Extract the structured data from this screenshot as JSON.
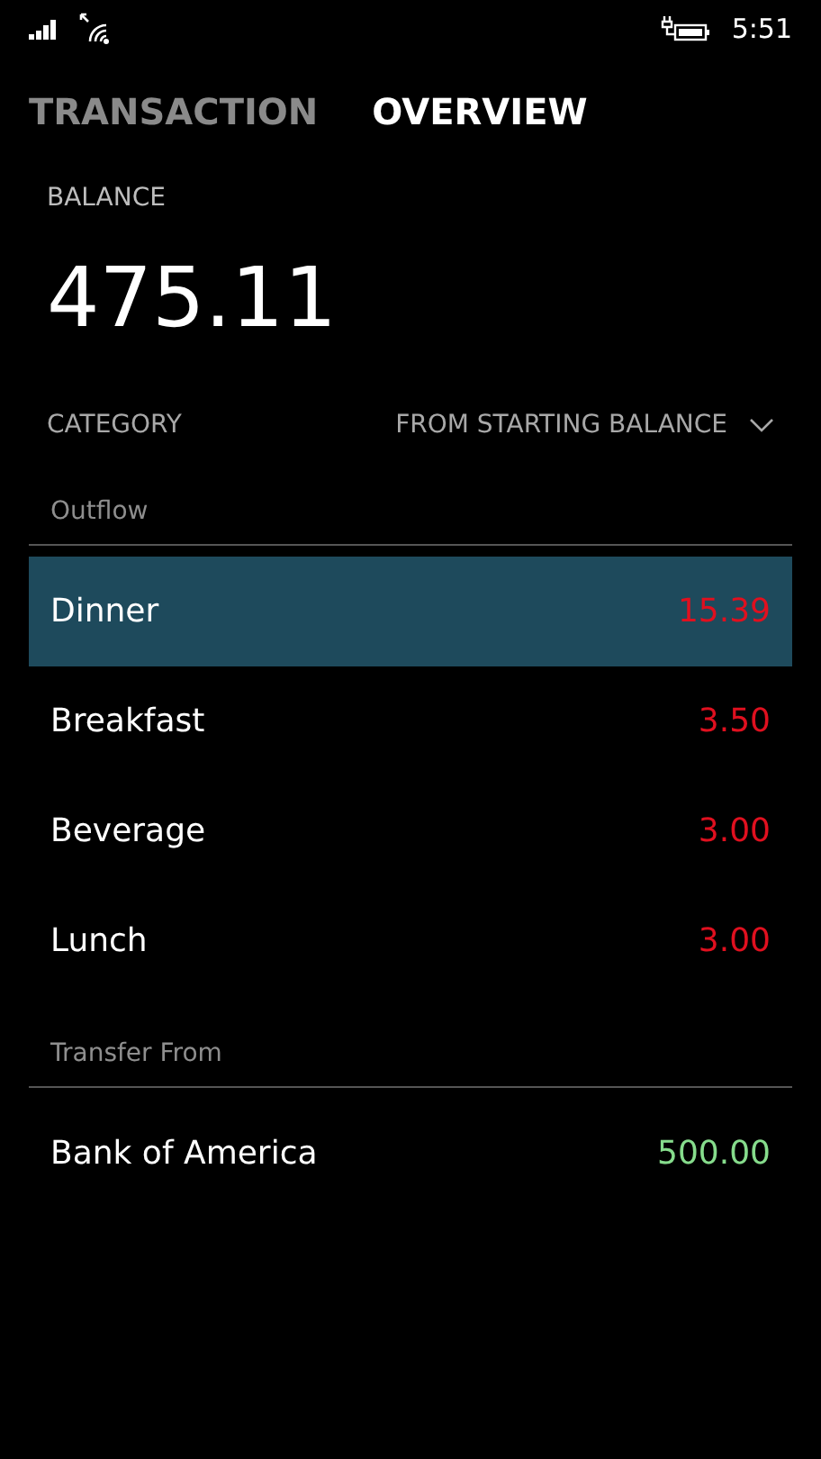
{
  "status_bar": {
    "time": "5:51"
  },
  "tabs": [
    {
      "label": "TRANSACTION",
      "selected": false
    },
    {
      "label": "OVERVIEW",
      "selected": true
    }
  ],
  "balance": {
    "label": "BALANCE",
    "value": "475.11"
  },
  "filter": {
    "label": "CATEGORY",
    "dropdown": "FROM STARTING BALANCE"
  },
  "groups": [
    {
      "title": "Outflow",
      "kind": "outflow",
      "rows": [
        {
          "name": "Dinner",
          "amount": "15.39",
          "selected": true
        },
        {
          "name": "Breakfast",
          "amount": "3.50",
          "selected": false
        },
        {
          "name": "Beverage",
          "amount": "3.00",
          "selected": false
        },
        {
          "name": "Lunch",
          "amount": "3.00",
          "selected": false
        }
      ]
    },
    {
      "title": "Transfer From",
      "kind": "inflow",
      "rows": [
        {
          "name": "Bank of America",
          "amount": "500.00",
          "selected": false
        }
      ]
    }
  ]
}
